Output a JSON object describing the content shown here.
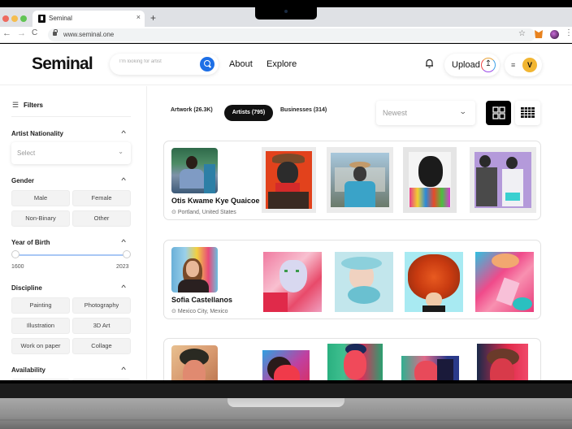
{
  "browser": {
    "tab_title": "Seminal",
    "tab_close": "×",
    "new_tab": "+",
    "url": "www.seminal.one",
    "nav": {
      "back": "←",
      "forward": "→",
      "reload": "C"
    },
    "star": "☆",
    "menu": "⋮"
  },
  "header": {
    "logo": "Seminal",
    "search_placeholder": "I'm looking for artist",
    "nav": [
      "About",
      "Explore"
    ],
    "upload_label": "Upload",
    "upload_icon": "↥",
    "menu_icon": "≡",
    "avatar_initial": "V"
  },
  "sidebar": {
    "filters_label": "Filters",
    "filters_icon": "☰",
    "sections": {
      "nationality": {
        "title": "Artist Nationality",
        "select_placeholder": "Select"
      },
      "gender": {
        "title": "Gender",
        "options": [
          "Male",
          "Female",
          "Non-Binary",
          "Other"
        ]
      },
      "year_of_birth": {
        "title": "Year of Birth",
        "min": "1600",
        "max": "2023",
        "range_low": 1600,
        "range_high": 2023
      },
      "discipline": {
        "title": "Discipline",
        "options": [
          "Painting",
          "Photography",
          "Illustration",
          "3D Art",
          "Work on paper",
          "Collage"
        ]
      },
      "availability": {
        "title": "Availability"
      }
    },
    "chevron_up": "^",
    "chevron_down": "⌄"
  },
  "main": {
    "tabs": [
      {
        "label": "Artwork (26.3K)",
        "active": false
      },
      {
        "label": "Artists (795)",
        "active": true
      },
      {
        "label": "Businesses (314)",
        "active": false
      }
    ],
    "sort": {
      "value": "Newest",
      "chevron": "⌄"
    },
    "view_modes": [
      "large-grid",
      "small-grid"
    ],
    "active_view": "large-grid",
    "artists": [
      {
        "name": "Otis Kwame Kye Quaicoe",
        "location": "Portland, United States"
      },
      {
        "name": "Sofia Castellanos",
        "location": "Mexico City, Mexico"
      },
      {
        "name": "",
        "location": ""
      }
    ]
  },
  "colors": {
    "accent_blue": "#1d6fe6",
    "avatar_yellow": "#f2b632",
    "active_tab": "#111111"
  }
}
